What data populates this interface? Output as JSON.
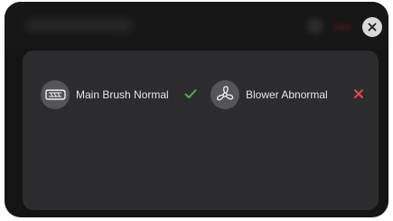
{
  "dialog": {
    "close_icon": "close-icon"
  },
  "status_items": [
    {
      "label": "Main Brush Normal",
      "icon": "main-brush-icon",
      "status": "normal",
      "status_icon": "check-icon",
      "status_color": "#4caf50"
    },
    {
      "label": "Blower Abnormal",
      "icon": "blower-fan-icon",
      "status": "abnormal",
      "status_icon": "cross-icon",
      "status_color": "#e5484d"
    }
  ],
  "colors": {
    "dialog_bg": "#141414",
    "panel_bg": "#2c2c2e",
    "icon_bg": "#555557",
    "ok": "#4caf50",
    "error": "#e5484d"
  }
}
